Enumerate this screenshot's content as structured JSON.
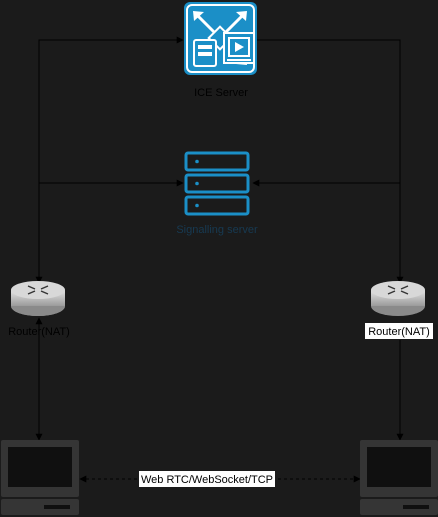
{
  "nodes": {
    "ice": {
      "label": "ICE Server",
      "icon": "ice-server-icon",
      "color": "#1b8fc7"
    },
    "signalling": {
      "label": "Signalling server",
      "icon": "server-rack-icon",
      "color": "#1b8fc7"
    },
    "router_left": {
      "label": "Router(NAT)",
      "icon": "router-icon"
    },
    "router_right": {
      "label": "Router(NAT)",
      "icon": "router-icon"
    },
    "computer_left": {
      "icon": "computer-icon"
    },
    "computer_right": {
      "icon": "computer-icon"
    }
  },
  "edges": {
    "peer_link": {
      "label": "Web RTC/WebSocket/TCP",
      "style": "dashed",
      "arrows": "both"
    }
  },
  "colors": {
    "background": "#1b1b1b",
    "line": "#000000",
    "icon_blue": "#1b8fc7",
    "router_body": "#c8c8c8",
    "computer_frame": "#353535",
    "computer_screen": "#101010"
  }
}
